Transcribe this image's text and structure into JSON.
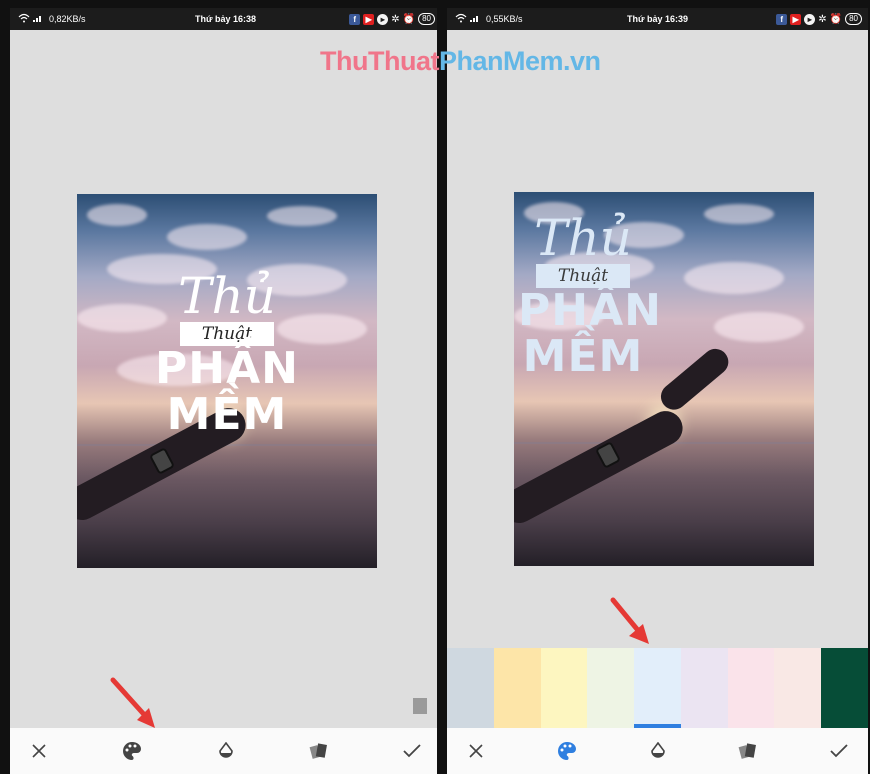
{
  "watermark": {
    "part1": "ThuThuat",
    "part2": "PhanMem",
    "part3": ".vn"
  },
  "left": {
    "status": {
      "speed": "0,82KB/s",
      "time": "Thứ bảy 16:38",
      "battery": "80"
    },
    "poster": {
      "line1": "Thủ",
      "line2": "Thuật",
      "line3": "PHẦN",
      "line4": "MỀM"
    },
    "toolbar": {
      "cancel": "cancel-icon",
      "color": "palette-icon",
      "opacity": "droplet-icon",
      "style": "layers-icon",
      "apply": "check-icon"
    }
  },
  "right": {
    "status": {
      "speed": "0,55KB/s",
      "time": "Thứ bảy 16:39",
      "battery": "80"
    },
    "poster": {
      "line1": "Thủ",
      "line2": "Thuật",
      "line3": "PHẦN",
      "line4": "MỀM"
    },
    "palette": {
      "colors": [
        "#cfd8e0",
        "#fde5a8",
        "#fdf6c0",
        "#eef4e4",
        "#e2eefa",
        "#ebe4f2",
        "#fae3ea",
        "#f9e8e5",
        "#064d37"
      ],
      "selected_index": 4
    },
    "toolbar": {
      "active_color": "#2f7fe0"
    }
  },
  "colors": {
    "arrow": "#e53935",
    "toolbar_icon": "#444444"
  }
}
